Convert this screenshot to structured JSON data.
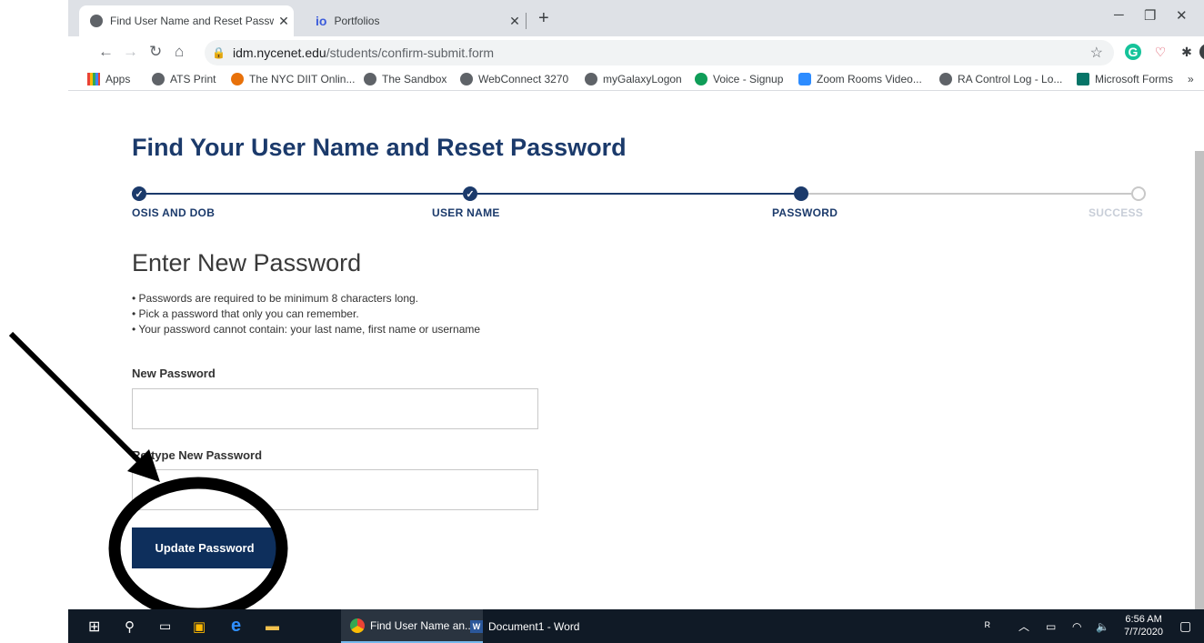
{
  "browser": {
    "tabs": [
      {
        "label": "Find User Name and Reset Passw",
        "icon": "globe-icon"
      },
      {
        "label": "Portfolios",
        "icon": "io-icon"
      }
    ],
    "url_host": "idm.nycenet.edu",
    "url_path": "/students/confirm-submit.form",
    "bookmarks": [
      "Apps",
      "ATS Print",
      "The NYC DIIT Onlin...",
      "The Sandbox",
      "WebConnect 3270",
      "myGalaxyLogon",
      "Voice - Signup",
      "Zoom Rooms Video...",
      "RA Control Log - Lo...",
      "Microsoft Forms"
    ],
    "more_bookmarks": "»"
  },
  "page": {
    "title": "Find Your User Name and Reset Password",
    "steps": [
      {
        "label": "OSIS AND DOB",
        "state": "done"
      },
      {
        "label": "USER NAME",
        "state": "done"
      },
      {
        "label": "PASSWORD",
        "state": "current"
      },
      {
        "label": "SUCCESS",
        "state": "future"
      }
    ],
    "heading": "Enter New Password",
    "rules": [
      "• Passwords are required to be minimum 8 characters long.",
      "• Pick a password that only you can remember.",
      "• Your password cannot contain: your last name, first name or username"
    ],
    "new_password_label": "New Password",
    "retype_label": "Re-type New Password",
    "submit_label": "Update Password"
  },
  "taskbar": {
    "apps": [
      "Find User Name an...",
      "Document1 - Word"
    ],
    "time": "6:56 AM",
    "date": "7/7/2020"
  },
  "colors": {
    "brand": "#1b3a6b",
    "button": "#0e2f5c"
  }
}
